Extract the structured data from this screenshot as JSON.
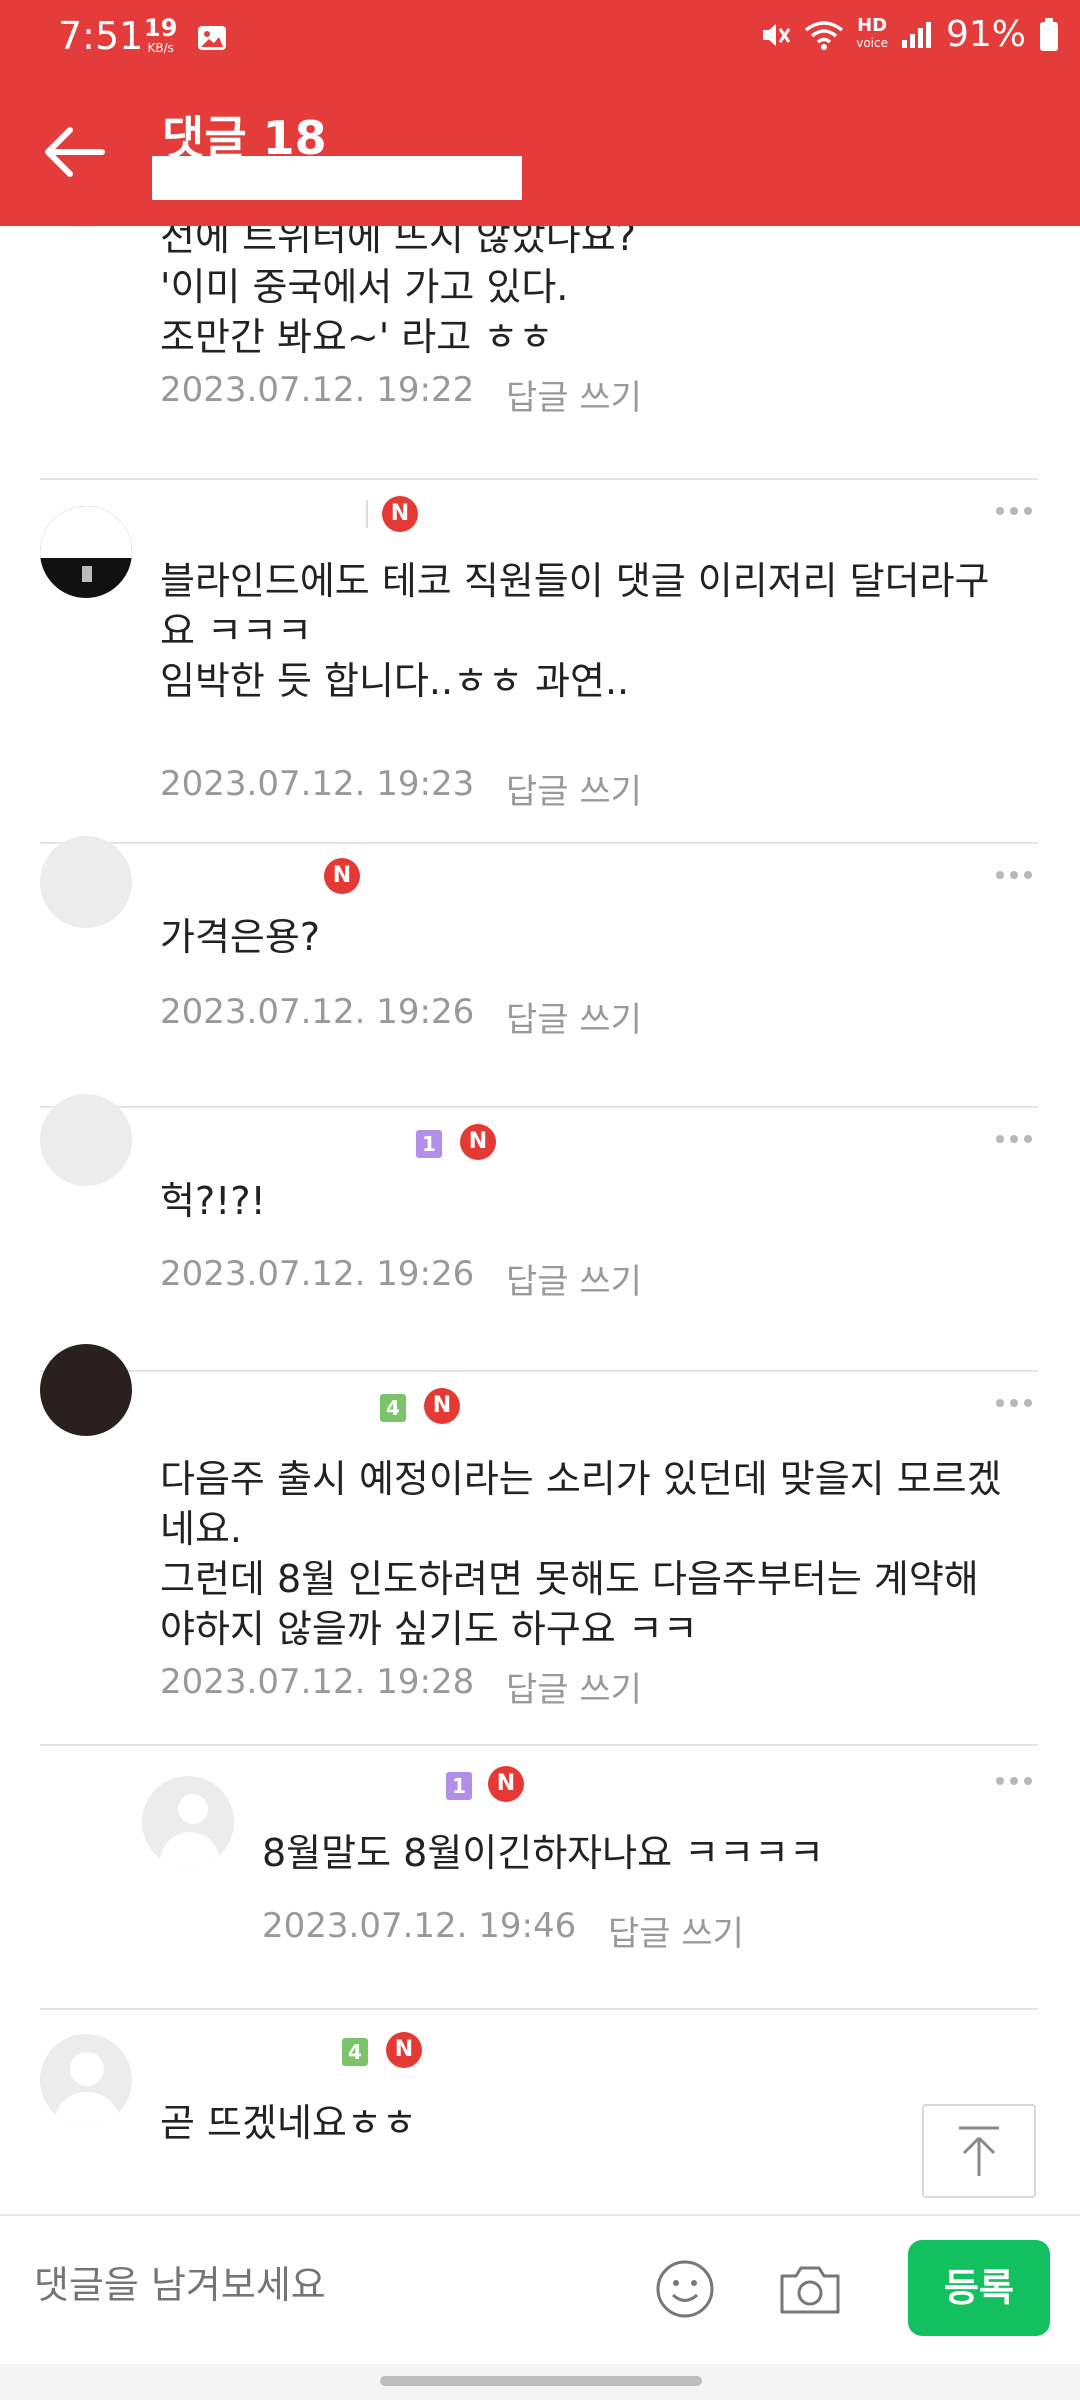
{
  "status_bar": {
    "time": "7:51",
    "net_speed_value": "19",
    "net_speed_unit": "KB/s",
    "hd_label": "HD",
    "hd_sub": "voice",
    "battery": "91%"
  },
  "app_bar": {
    "title": "댓글 18",
    "back_icon": "arrow-left-icon"
  },
  "comments": [
    {
      "text": "전에 트위터에 뜨지 않았나요?\n'이미 중국에서 가고 있다.\n조만간 봐요~' 라고 ㅎㅎ",
      "date": "2023.07.12. 19:22",
      "reply_label": "답글 쓰기"
    },
    {
      "badge": "N",
      "text": "블라인드에도 테코 직원들이 댓글 이리저리 달더라구\n요 ㅋㅋㅋ\n임박한 듯 합니다..ㅎㅎ 과연..",
      "date": "2023.07.12. 19:23",
      "reply_label": "답글 쓰기"
    },
    {
      "badge": "N",
      "text": "가격은용?",
      "date": "2023.07.12. 19:26",
      "reply_label": "답글 쓰기"
    },
    {
      "level": "1",
      "badge": "N",
      "text": "헉?!?!",
      "date": "2023.07.12. 19:26",
      "reply_label": "답글 쓰기"
    },
    {
      "level": "4",
      "badge": "N",
      "text": "다음주 출시 예정이라는 소리가 있던데 맞을지 모르겠\n네요.\n그런데 8월 인도하려면 못해도 다음주부터는 계약해\n야하지 않을까 싶기도 하구요 ㅋㅋ",
      "date": "2023.07.12. 19:28",
      "reply_label": "답글 쓰기"
    },
    {
      "level": "1",
      "badge": "N",
      "text": "8월말도 8월이긴하자나요 ㅋㅋㅋㅋ",
      "date": "2023.07.12. 19:46",
      "reply_label": "답글 쓰기"
    },
    {
      "level": "4",
      "badge": "N",
      "text": "곧 뜨겠네요ㅎㅎ"
    }
  ],
  "composer": {
    "placeholder": "댓글을 남겨보세요",
    "submit_label": "등록"
  },
  "colors": {
    "brand_red": "#e33c3a",
    "submit_green": "#13c060",
    "new_badge_red": "#e53935"
  }
}
